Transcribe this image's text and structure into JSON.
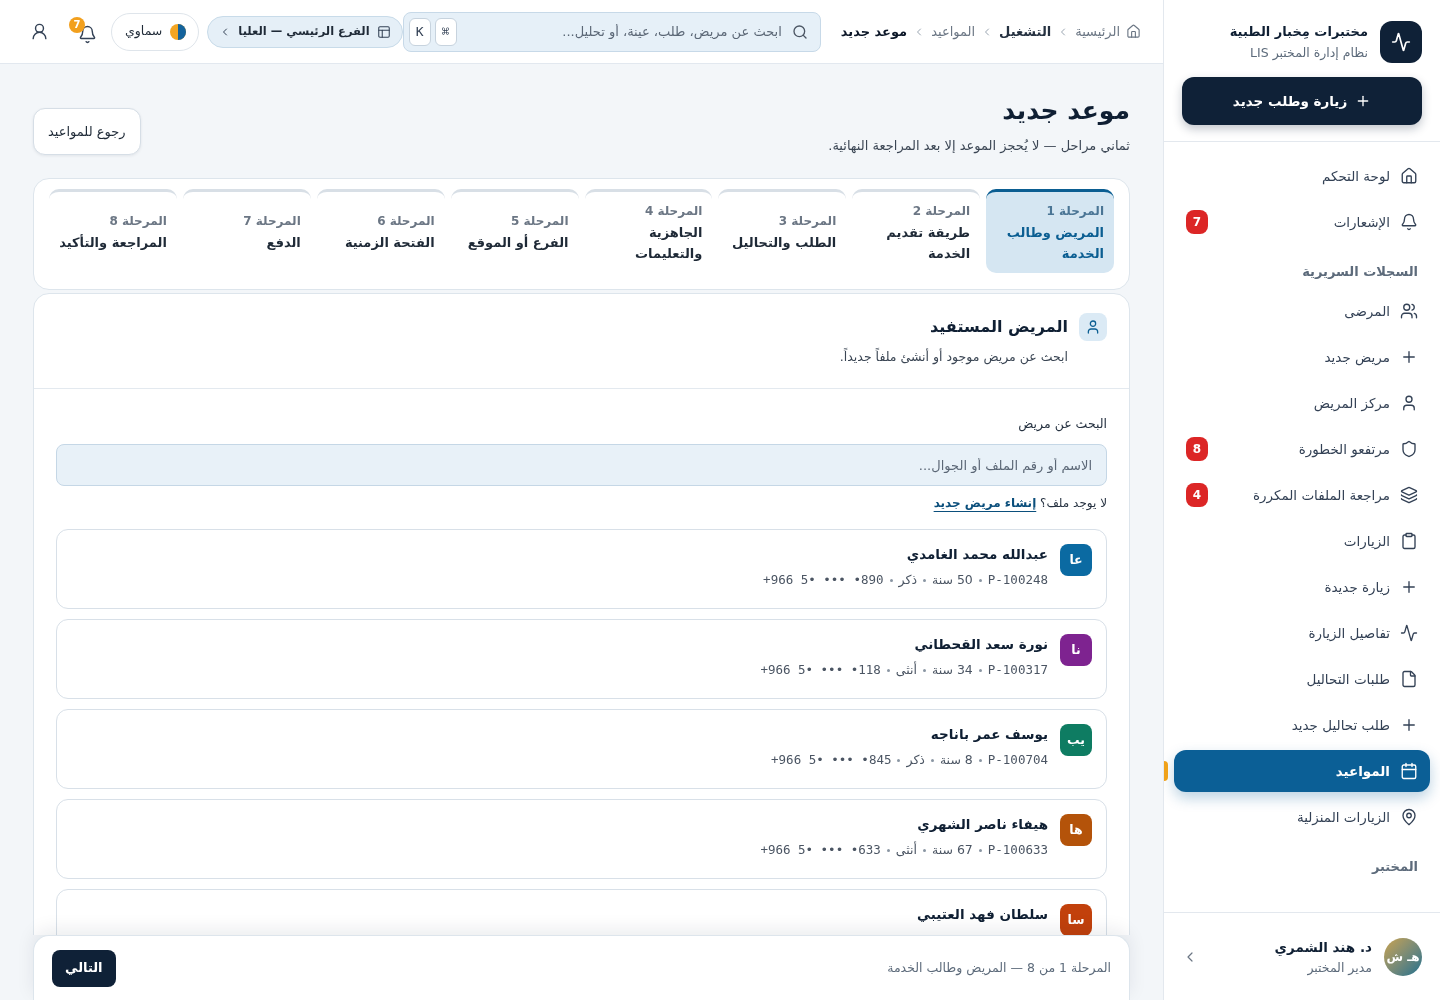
{
  "sidebar": {
    "brand": {
      "title": "مختبرات مِخبار الطبية",
      "subtitle": "نظام إدارة المختبر LIS"
    },
    "new_button": "زيارة وطلب جديد",
    "nav": [
      {
        "kind": "item",
        "label": "لوحة التحكم",
        "selected": false
      },
      {
        "kind": "item",
        "label": "الإشعارات",
        "badge": "7",
        "selected": false
      },
      {
        "kind": "heading",
        "label": "السجلات السريرية"
      },
      {
        "kind": "item",
        "label": "المرضى",
        "selected": false
      },
      {
        "kind": "item",
        "label": "مريض جديد",
        "selected": false
      },
      {
        "kind": "item",
        "label": "مركز المريض",
        "selected": false
      },
      {
        "kind": "item",
        "label": "مرتفعو الخطورة",
        "badge": "8",
        "selected": false
      },
      {
        "kind": "item",
        "label": "مراجعة الملفات المكررة",
        "badge": "4",
        "selected": false
      },
      {
        "kind": "item",
        "label": "الزيارات",
        "selected": false
      },
      {
        "kind": "item",
        "label": "زيارة جديدة",
        "selected": false
      },
      {
        "kind": "item",
        "label": "تفاصيل الزيارة",
        "selected": false
      },
      {
        "kind": "item",
        "label": "طلبات التحاليل",
        "selected": false
      },
      {
        "kind": "item",
        "label": "طلب تحاليل جديد",
        "selected": false
      },
      {
        "kind": "item",
        "label": "المواعيد",
        "selected": true
      },
      {
        "kind": "item",
        "label": "الزيارات المنزلية",
        "selected": false
      },
      {
        "kind": "heading",
        "label": "المختبر"
      }
    ],
    "user": {
      "initials": "هـ ش",
      "name": "د. هند الشمري",
      "role": "مدير المختبر"
    }
  },
  "topbar": {
    "breadcrumbs": [
      {
        "kind": "link",
        "label": "الرئيسية"
      },
      {
        "kind": "section",
        "label": "التشغيل"
      },
      {
        "kind": "link",
        "label": "المواعيد"
      },
      {
        "kind": "current",
        "label": "موعد جديد"
      }
    ],
    "search": {
      "placeholder": "ابحث عن مريض، طلب، عينة، أو تحليل...",
      "shortcut_keys": [
        "⌘",
        "K"
      ]
    },
    "branch": "الفرع الرئيسي — العليا",
    "theme": "سماوي",
    "notifications_badge": "7"
  },
  "page": {
    "title": "موعد جديد",
    "subtitle": "ثماني مراحل — لا يُحجز الموعد إلا بعد المراجعة النهائية.",
    "back_button": "رجوع للمواعيد"
  },
  "steps": [
    {
      "label": "المرحلة 1",
      "title": "المريض وطالب الخدمة",
      "selected": true
    },
    {
      "label": "المرحلة 2",
      "title": "طريقة تقديم الخدمة",
      "selected": false
    },
    {
      "label": "المرحلة 3",
      "title": "الطلب والتحاليل",
      "selected": false
    },
    {
      "label": "المرحلة 4",
      "title": "الجاهزية والتعليمات",
      "selected": false
    },
    {
      "label": "المرحلة 5",
      "title": "الفرع أو الموقع",
      "selected": false
    },
    {
      "label": "المرحلة 6",
      "title": "الفتحة الزمنية",
      "selected": false
    },
    {
      "label": "المرحلة 7",
      "title": "الدفع",
      "selected": false
    },
    {
      "label": "المرحلة 8",
      "title": "المراجعة والتأكيد",
      "selected": false
    }
  ],
  "patient_section": {
    "title": "المريض المستفيد",
    "description": "ابحث عن مريض موجود أو أنشئ ملفاً جديداً.",
    "search_label": "البحث عن مريض",
    "search_placeholder": "الاسم أو رقم الملف أو الجوال...",
    "no_file_prompt": "لا يوجد ملف؟",
    "create_link": "إنشاء مريض جديد",
    "results": [
      {
        "initials": "عا",
        "name": "عبدالله محمد الغامدي",
        "file_no": "P-100248",
        "age": "50 سنة",
        "gender": "ذكر",
        "phone": "+966 5• ••• •890",
        "color": "#0b6aa2"
      },
      {
        "initials": "نا",
        "name": "نورة سعد القحطاني",
        "file_no": "P-100317",
        "age": "34 سنة",
        "gender": "أنثى",
        "phone": "+966 5• ••• •118",
        "color": "#7e2390"
      },
      {
        "initials": "يب",
        "name": "يوسف عمر باناجه",
        "file_no": "P-100704",
        "age": "8 سنة",
        "gender": "ذكر",
        "phone": "+966 5• ••• •845",
        "color": "#0e7c62"
      },
      {
        "initials": "ها",
        "name": "هيفاء ناصر الشهري",
        "file_no": "P-100633",
        "age": "67 سنة",
        "gender": "أنثى",
        "phone": "+966 5• ••• •633",
        "color": "#b4530a"
      },
      {
        "initials": "سا",
        "name": "سلطان فهد العتيبي",
        "color": "#c2410c"
      }
    ]
  },
  "footer": {
    "progress": "المرحلة 1 من 8 — المريض وطالب الخدمة",
    "next_button": "التالي"
  }
}
